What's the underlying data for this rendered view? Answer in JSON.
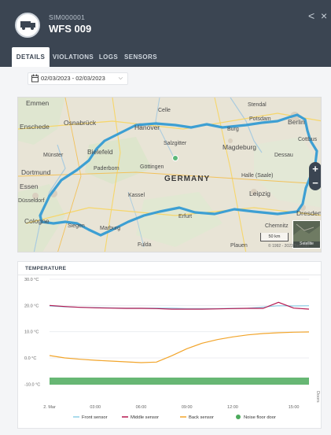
{
  "header": {
    "sim_id": "SIM000001",
    "vehicle_name": "WFS 009",
    "icons": [
      "truck-icon",
      "back-icon",
      "close-icon"
    ],
    "back_glyph": "<",
    "close_glyph": "×"
  },
  "tabs": [
    {
      "label": "DETAILS",
      "active": true
    },
    {
      "label": "VIOLATIONS",
      "active": false
    },
    {
      "label": "LOGS",
      "active": false
    },
    {
      "label": "SENSORS",
      "active": false
    }
  ],
  "date_range": {
    "value": "02/03/2023 - 02/03/2023"
  },
  "map": {
    "labels": {
      "emmen": "Emmen",
      "enschede": "Enschede",
      "osnabruck": "Osnabrück",
      "bielefeld": "Bielefeld",
      "munster": "Münster",
      "dortmund": "Dortmund",
      "essen": "Essen",
      "dusseldorf": "Düsseldorf",
      "cologne": "Cologne",
      "paderborn": "Paderborn",
      "kassel": "Kassel",
      "siegen": "Siegen",
      "marburg": "Marburg",
      "hanover": "Hanover",
      "celle": "Celle",
      "salzgitter": "Salzgitter",
      "magdeburg": "Magdeburg",
      "stendal": "Stendal",
      "potsdam": "Potsdam",
      "berlin": "Berlin",
      "germany": "GERMANY",
      "halle": "Halle (Saale)",
      "leipzig": "Leipzig",
      "dresden": "Dresden",
      "erfurt": "Erfurt",
      "gottingen": "Göttingen",
      "fulda": "Fulda",
      "dessau": "Dessau",
      "burg": "Burg",
      "cottbus": "Cottbus",
      "plauen": "Plauen",
      "chemnitz": "Chemnitz"
    },
    "zoom_in": "+",
    "zoom_out": "−",
    "satellite_label": "Satellite",
    "scale_label": "50 km",
    "copyright": "© 1992 - 2023 TomTom"
  },
  "temperature": {
    "title": "TEMPERATURE"
  },
  "chart_data": {
    "type": "line",
    "title": "TEMPERATURE",
    "x": [
      "00:00",
      "01:00",
      "02:00",
      "03:00",
      "04:00",
      "05:00",
      "06:00",
      "07:00",
      "08:00",
      "09:00",
      "10:00",
      "11:00",
      "12:00",
      "13:00",
      "14:00",
      "14:30",
      "15:00",
      "15:30"
    ],
    "x_ticks": [
      "2. Mar",
      "03:00",
      "06:00",
      "09:00",
      "12:00",
      "15:00"
    ],
    "y_ticks": [
      "30.0 °C",
      "20.0 °C",
      "10.0 °C",
      "0.0 °C",
      "-10.0 °C"
    ],
    "ylim": [
      -15,
      30
    ],
    "y2label": "Doors",
    "series": [
      {
        "name": "Front sensor",
        "color": "#8fcfe6",
        "values": [
          19.8,
          19.5,
          19.3,
          19.2,
          19.1,
          19.0,
          19.0,
          19.0,
          19.0,
          18.8,
          18.8,
          18.8,
          18.9,
          19.0,
          19.4,
          19.9,
          19.8,
          19.9
        ]
      },
      {
        "name": "Middle sensor",
        "color": "#b5174f",
        "values": [
          20.0,
          19.6,
          19.3,
          19.1,
          19.0,
          18.9,
          18.9,
          18.8,
          18.6,
          18.6,
          18.6,
          18.7,
          18.8,
          18.9,
          18.9,
          21.2,
          19.0,
          18.6
        ]
      },
      {
        "name": "Back sensor",
        "color": "#f2a52b",
        "values": [
          0.9,
          0.0,
          -0.5,
          -0.9,
          -1.2,
          -1.5,
          -1.8,
          -1.6,
          0.8,
          3.5,
          5.6,
          7.0,
          8.0,
          8.8,
          9.3,
          9.6,
          9.8,
          9.9
        ]
      },
      {
        "name": "Noise floor door",
        "color": "#4caa5c",
        "values": [
          -14,
          -14,
          -14,
          -14,
          -14,
          -14,
          -14,
          -14,
          -14,
          -14,
          -14,
          -14,
          -14,
          -14,
          -14,
          -14,
          -14,
          -14
        ]
      }
    ],
    "grid": true,
    "legend": "bottom"
  }
}
